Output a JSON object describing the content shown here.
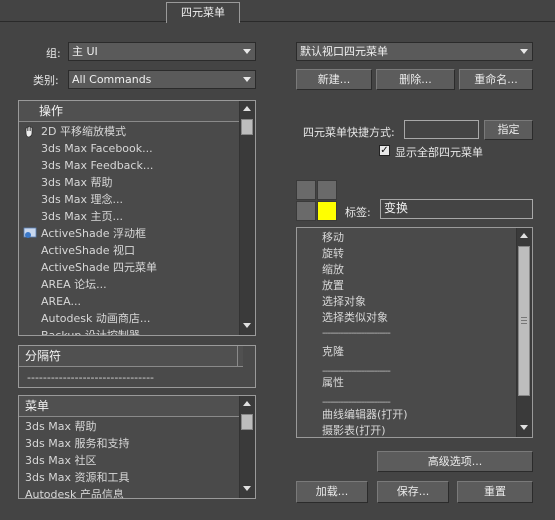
{
  "tab": {
    "label": "四元菜单"
  },
  "left": {
    "group_label": "组:",
    "group_value": "主 UI",
    "category_label": "类别:",
    "category_value": "All Commands",
    "actions": {
      "header": "操作",
      "items": [
        {
          "label": "2D 平移缩放模式",
          "icon": "hand-icon"
        },
        {
          "label": "3ds Max Facebook..."
        },
        {
          "label": "3ds Max Feedback..."
        },
        {
          "label": "3ds Max 帮助"
        },
        {
          "label": "3ds Max 理念..."
        },
        {
          "label": "3ds Max 主页..."
        },
        {
          "label": "ActiveShade 浮动框",
          "icon": "activeshade-icon"
        },
        {
          "label": "ActiveShade 视口"
        },
        {
          "label": "ActiveShade 四元菜单"
        },
        {
          "label": "AREA 论坛..."
        },
        {
          "label": "AREA..."
        },
        {
          "label": "Autodesk 动画商店..."
        },
        {
          "label": "Backup 设计控制器"
        }
      ]
    },
    "separators": {
      "header": "分隔符",
      "item": "--------------------------------"
    },
    "menus": {
      "header": "菜单",
      "items": [
        "3ds Max 帮助",
        "3ds Max 服务和支持",
        "3ds Max 社区",
        "3ds Max 资源和工具",
        "Autodesk 产品信息"
      ]
    }
  },
  "right": {
    "quad_select_value": "默认视口四元菜单",
    "buttons": {
      "new": "新建...",
      "delete": "删除...",
      "rename": "重命名..."
    },
    "shortcut_label": "四元菜单快捷方式:",
    "shortcut_value": "",
    "assign_button": "指定",
    "show_all_label": "显示全部四元菜单",
    "show_all_checked": "✓",
    "tag_label": "标签:",
    "tag_value": "变换",
    "active_quad_color": "#ffff00",
    "items": [
      {
        "label": "移动"
      },
      {
        "label": "旋转"
      },
      {
        "label": "缩放"
      },
      {
        "label": "放置"
      },
      {
        "label": "选择对象"
      },
      {
        "label": "选择类似对象"
      },
      {
        "label": "--------------------------"
      },
      {
        "label": "克隆"
      },
      {
        "label": "--------------------------"
      },
      {
        "label": "属性"
      },
      {
        "label": "--------------------------"
      },
      {
        "label": "曲线编辑器(打开)"
      },
      {
        "label": "摄影表(打开)"
      }
    ],
    "advanced_button": "高级选项...",
    "load_button": "加载...",
    "save_button": "保存...",
    "reset_button": "重置"
  }
}
